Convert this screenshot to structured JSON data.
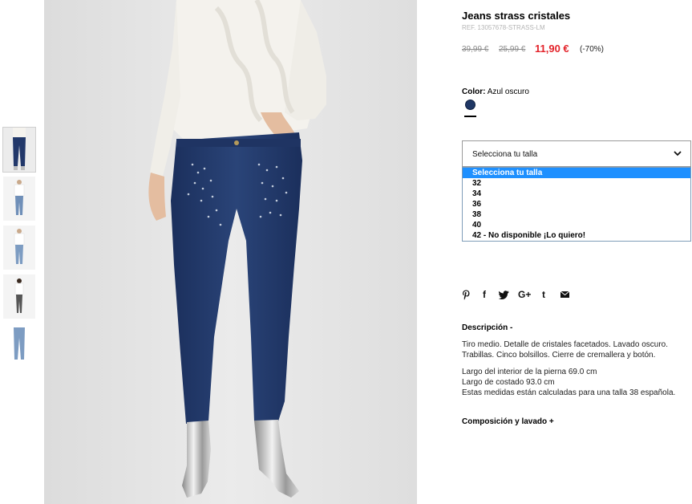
{
  "product": {
    "title": "Jeans strass cristales",
    "ref": "REF. 13057678-STRASS-LM",
    "price_original": "39,99 €",
    "price_previous": "25,99 €",
    "price_current": "11,90 €",
    "discount": "(-70%)"
  },
  "color": {
    "label": "Color:",
    "value": "Azul oscuro",
    "swatch_hex": "#1f3765"
  },
  "size_select": {
    "label": "Selecciona tu talla",
    "options": [
      "Selecciona tu talla",
      "32",
      "34",
      "36",
      "38",
      "40",
      "42 - No disponible ¡Lo quiero!"
    ],
    "selected_index": 0
  },
  "social": [
    "pinterest-icon",
    "facebook-icon",
    "twitter-icon",
    "google-plus-icon",
    "tumblr-icon",
    "email-icon"
  ],
  "social_glyphs": [
    "℗",
    "f",
    "🐦",
    "G+",
    "t",
    "✉"
  ],
  "description": {
    "heading": "Descripción  -",
    "lines1": [
      "Tiro medio. Detalle de cristales facetados. Lavado oscuro.",
      "Trabillas. Cinco bolsillos. Cierre de cremallera y botón."
    ],
    "lines2": [
      "Largo del interior de la pierna 69.0 cm",
      "Largo de costado 93.0 cm",
      "Estas medidas están calculadas para una talla 38 española."
    ]
  },
  "composition_heading": "Composición y lavado  +",
  "colors": {
    "accent_price": "#e3232a",
    "select_highlight": "#1e90ff",
    "denim": "#22386a",
    "sweater": "#f3f1ec"
  }
}
